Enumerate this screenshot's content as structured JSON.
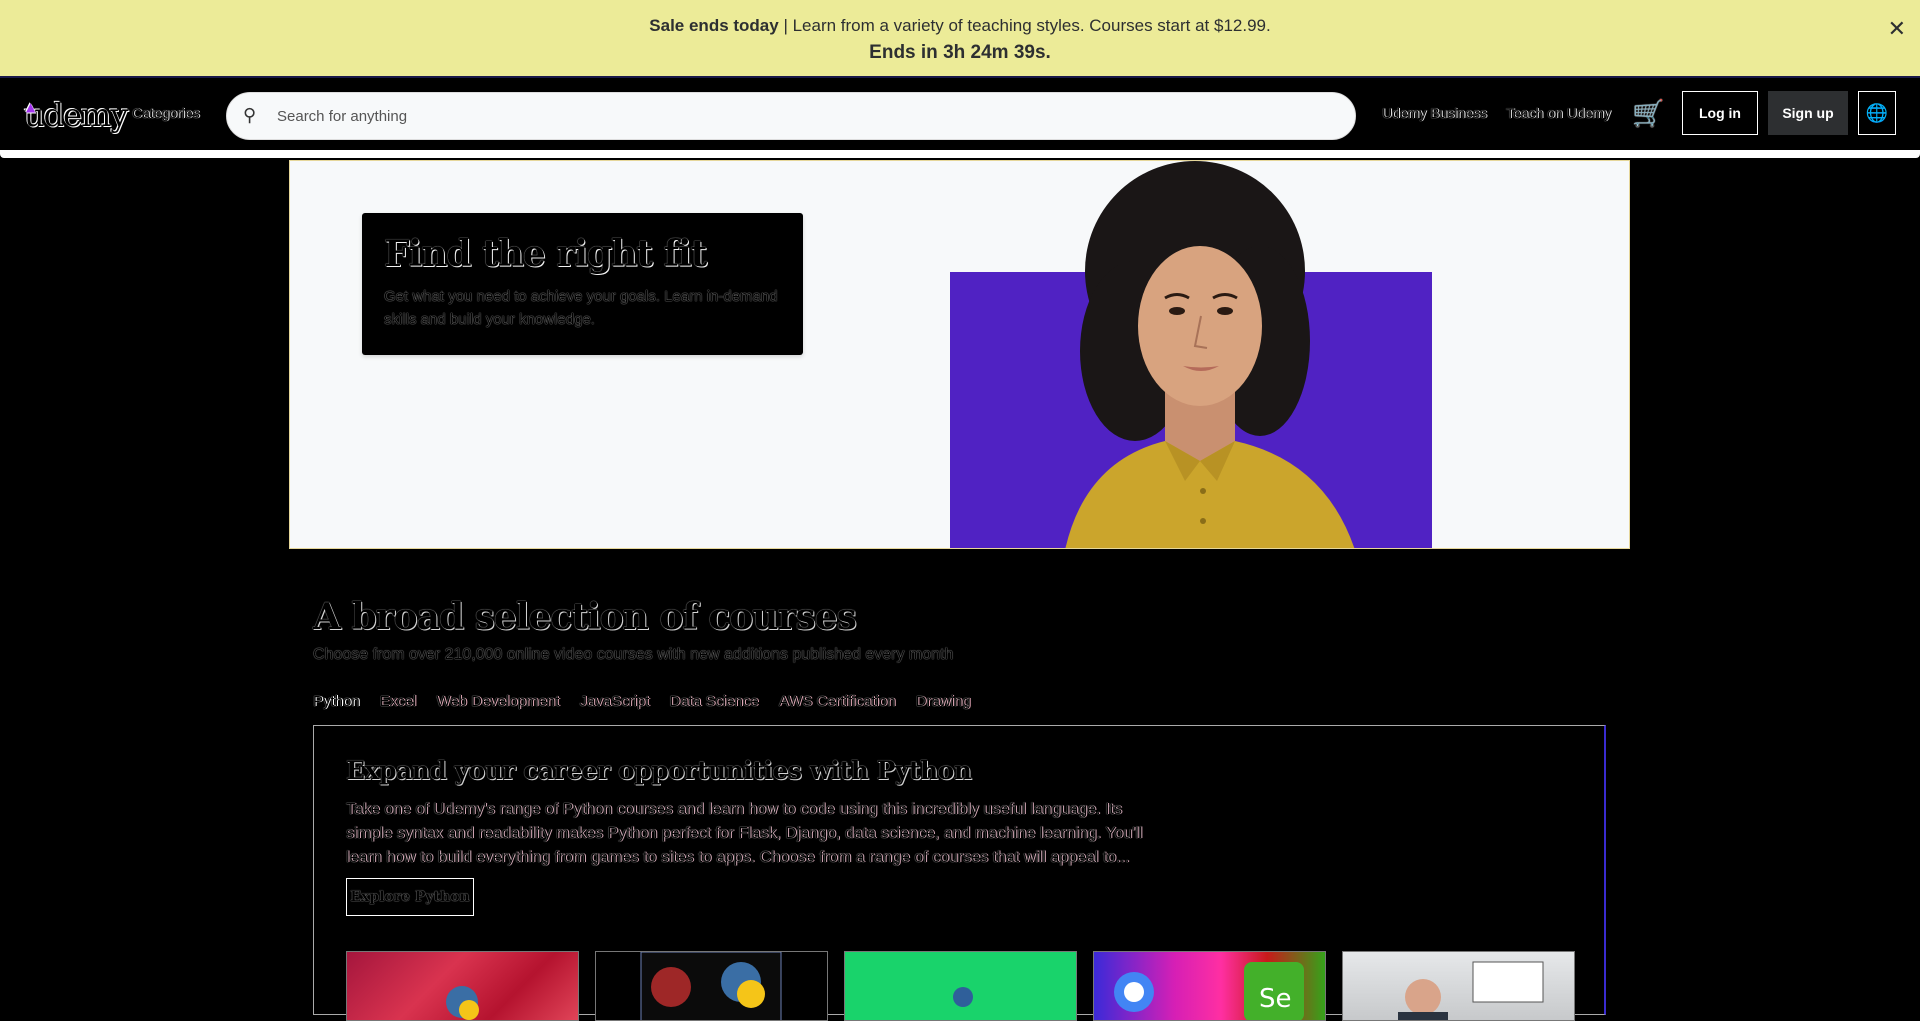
{
  "banner": {
    "sale_bold": "Sale ends today",
    "sale_text": " | Learn from a variety of teaching styles. Courses start at $12.99.",
    "countdown": "Ends in 3h 24m 39s."
  },
  "header": {
    "logo": "udemy",
    "categories": "Categories",
    "search_placeholder": "Search for anything",
    "business": "Udemy Business",
    "teach": "Teach on Udemy",
    "login": "Log in",
    "signup": "Sign up"
  },
  "hero": {
    "title": "Find the right fit",
    "subtitle": "Get what you need to achieve your goals. Learn in-demand skills and build your knowledge."
  },
  "section": {
    "title": "A broad selection of courses",
    "subtitle": "Choose from over 210,000 online video courses with new additions published every month",
    "tabs": [
      "Python",
      "Excel",
      "Web Development",
      "JavaScript",
      "Data Science",
      "AWS Certification",
      "Drawing"
    ]
  },
  "panel": {
    "title": "Expand your career opportunities with Python",
    "desc": "Take one of Udemy's range of Python courses and learn how to code using this incredibly useful language. Its simple syntax and readability makes Python perfect for Flask, Django, data science, and machine learning. You'll learn how to build everything from games to sites to apps. Choose from a range of courses that will appeal to...",
    "explore": "Explore Python"
  },
  "colors": {
    "banner_bg": "#eceb98",
    "brand_purple": "#5022c3",
    "accent": "#a435f0"
  }
}
